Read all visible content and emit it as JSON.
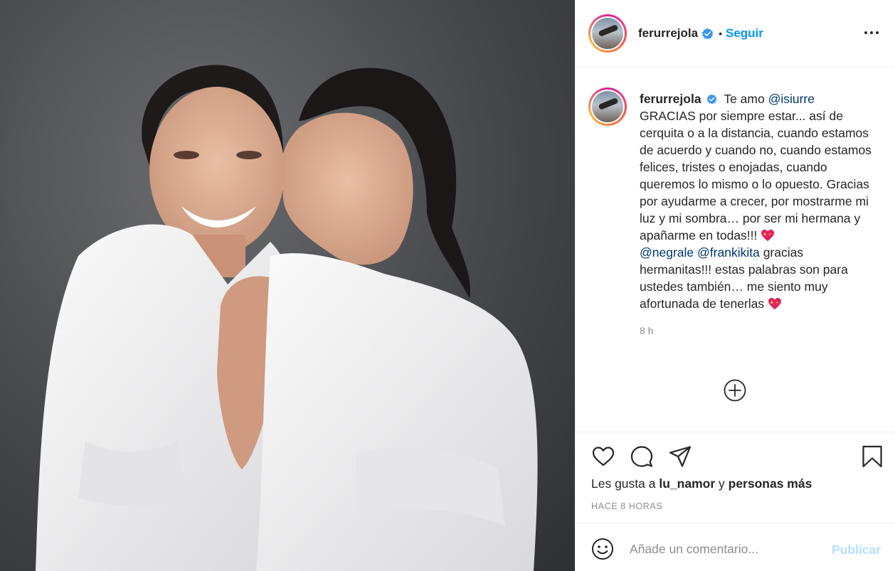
{
  "post": {
    "author": {
      "username": "ferurrejola",
      "verified_icon": "verified-badge-icon",
      "follow_label": "Seguir",
      "separator": "•"
    },
    "caption": {
      "username": "ferurrejola",
      "part1": "Te amo ",
      "mention1": "@isiurre",
      "part2": "GRACIAS por siempre estar... así de cerquita o a la distancia, cuando estamos de acuerdo y cuando no, cuando estamos felices, tristes o enojadas, cuando queremos lo mismo o lo opuesto. Gracias por ayudarme a crecer, por mostrarme mi luz y mi sombra… por ser mi hermana y apañarme en todas!!! ",
      "mention2": "@negrale",
      "mention3": "@frankikita",
      "part3": " gracias hermanitas!!! estas palabras son para ustedes también… me siento muy afortunada de tenerlas ",
      "emoji": "sparkling-heart-icon",
      "time_ago": "8 h"
    },
    "likes": {
      "prefix": "Les gusta a ",
      "user": "lu_namor",
      "middle": " y ",
      "others": "personas más"
    },
    "posted": "HACE 8 HORAS",
    "comment_box": {
      "placeholder": "Añade un comentario...",
      "publish_label": "Publicar"
    },
    "icons": [
      "heart-icon",
      "comment-icon",
      "share-icon",
      "bookmark-icon",
      "load-more-icon",
      "emoji-icon",
      "more-options-icon"
    ],
    "colors": {
      "follow": "#0095f6",
      "publish_disabled": "#b2dffc",
      "mention": "#00376b",
      "meta": "#8e8e8e"
    }
  }
}
